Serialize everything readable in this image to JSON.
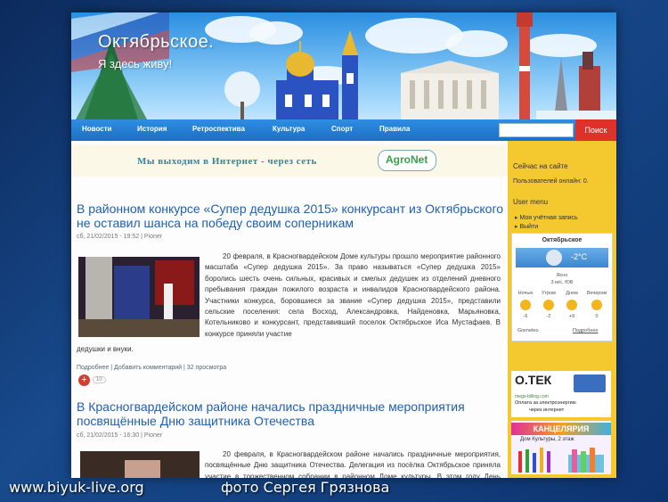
{
  "site": {
    "title": "Октябрьское.",
    "subtitle": "Я здесь живу!"
  },
  "nav": {
    "items": [
      "Новости",
      "История",
      "Ретроспектива",
      "Культура",
      "Спорт",
      "Правила"
    ],
    "search_label": "Поиск"
  },
  "promo": {
    "text": "Мы выходим в Интернет - через сеть",
    "logo": "AgroNet"
  },
  "articles": [
    {
      "title": "В районном конкурсе «Супер дедушка 2015» конкурсант из Октябрьского не оставил шанса на победу своим соперникам",
      "date": "сб, 21/02/2015 - 19:52",
      "author": "Pioner",
      "body_indent": "20 февраля, в Красногвардейском Доме культуры прошло мероприятие районного масштаба «Супер дедушка 2015». За право называться «Супер дедушка 2015» боролись шесть очень сильных, красивых и смелых дедушек из отделений дневного пребывания граждан пожилого возраста и инвалидов Красногвардейского района. Участники конкурса, боровшиеся за звание «Супер дедушка 2015», представили сельские поселения: села Восход, Александровка, Найденовка, Марьяновка, Котельниково и конкурсант, представивший поселок Октябрьское Иса Мустафаев. В конкурсе приняли участие",
      "body_tail": "дедушки и внуки.",
      "more": "Подробнее",
      "comment": "Добавить комментарий",
      "views": "32 просмотра",
      "count": "10"
    },
    {
      "title": "В Красногвардейском районе начались праздничные мероприятия посвящённые Дню защитника Отечества",
      "date": "сб, 21/02/2015 - 16:30",
      "author": "Pioner",
      "body_indent": "20 февраля, в Красногвардейском районе начались праздничные мероприятия, посвящённые Дню защитника Отечества. Делегация из посёлка Октябрьское приняла участие в торжественном собрании в районном Доме культуры. В этом году День защитника Отечества"
    }
  ],
  "sidebar": {
    "online_heading": "Сейчас на сайте",
    "online_users": "Пользователей онлайн: 0.",
    "user_menu": "User menu",
    "account_link": "Моя учётная запись",
    "logout_link": "Выйти"
  },
  "weather": {
    "city": "Октябрьское",
    "temp": "-2°C",
    "condition": "Ясно",
    "wind": "3 м/с, ЮВ",
    "periods": [
      "Ночью",
      "Утром",
      "Днем",
      "Вечером"
    ],
    "temps": [
      "-6",
      "-2",
      "+9",
      "0"
    ],
    "provider": "Gismeteo",
    "more": "Подробнее"
  },
  "ads": {
    "otek_brand": "О.ТЕК",
    "otek_site": "mego-billing.com",
    "otek_line1": "Оплата за электроэнергию",
    "otek_line2": "через интернет",
    "stationery": "КАНЦЕЛЯРИЯ",
    "stationery_sub": "Дом Культуры, 2 этаж"
  },
  "watermark": {
    "site": "www.biyuk-live.org",
    "credit": "фото Сергея Грязнова"
  }
}
